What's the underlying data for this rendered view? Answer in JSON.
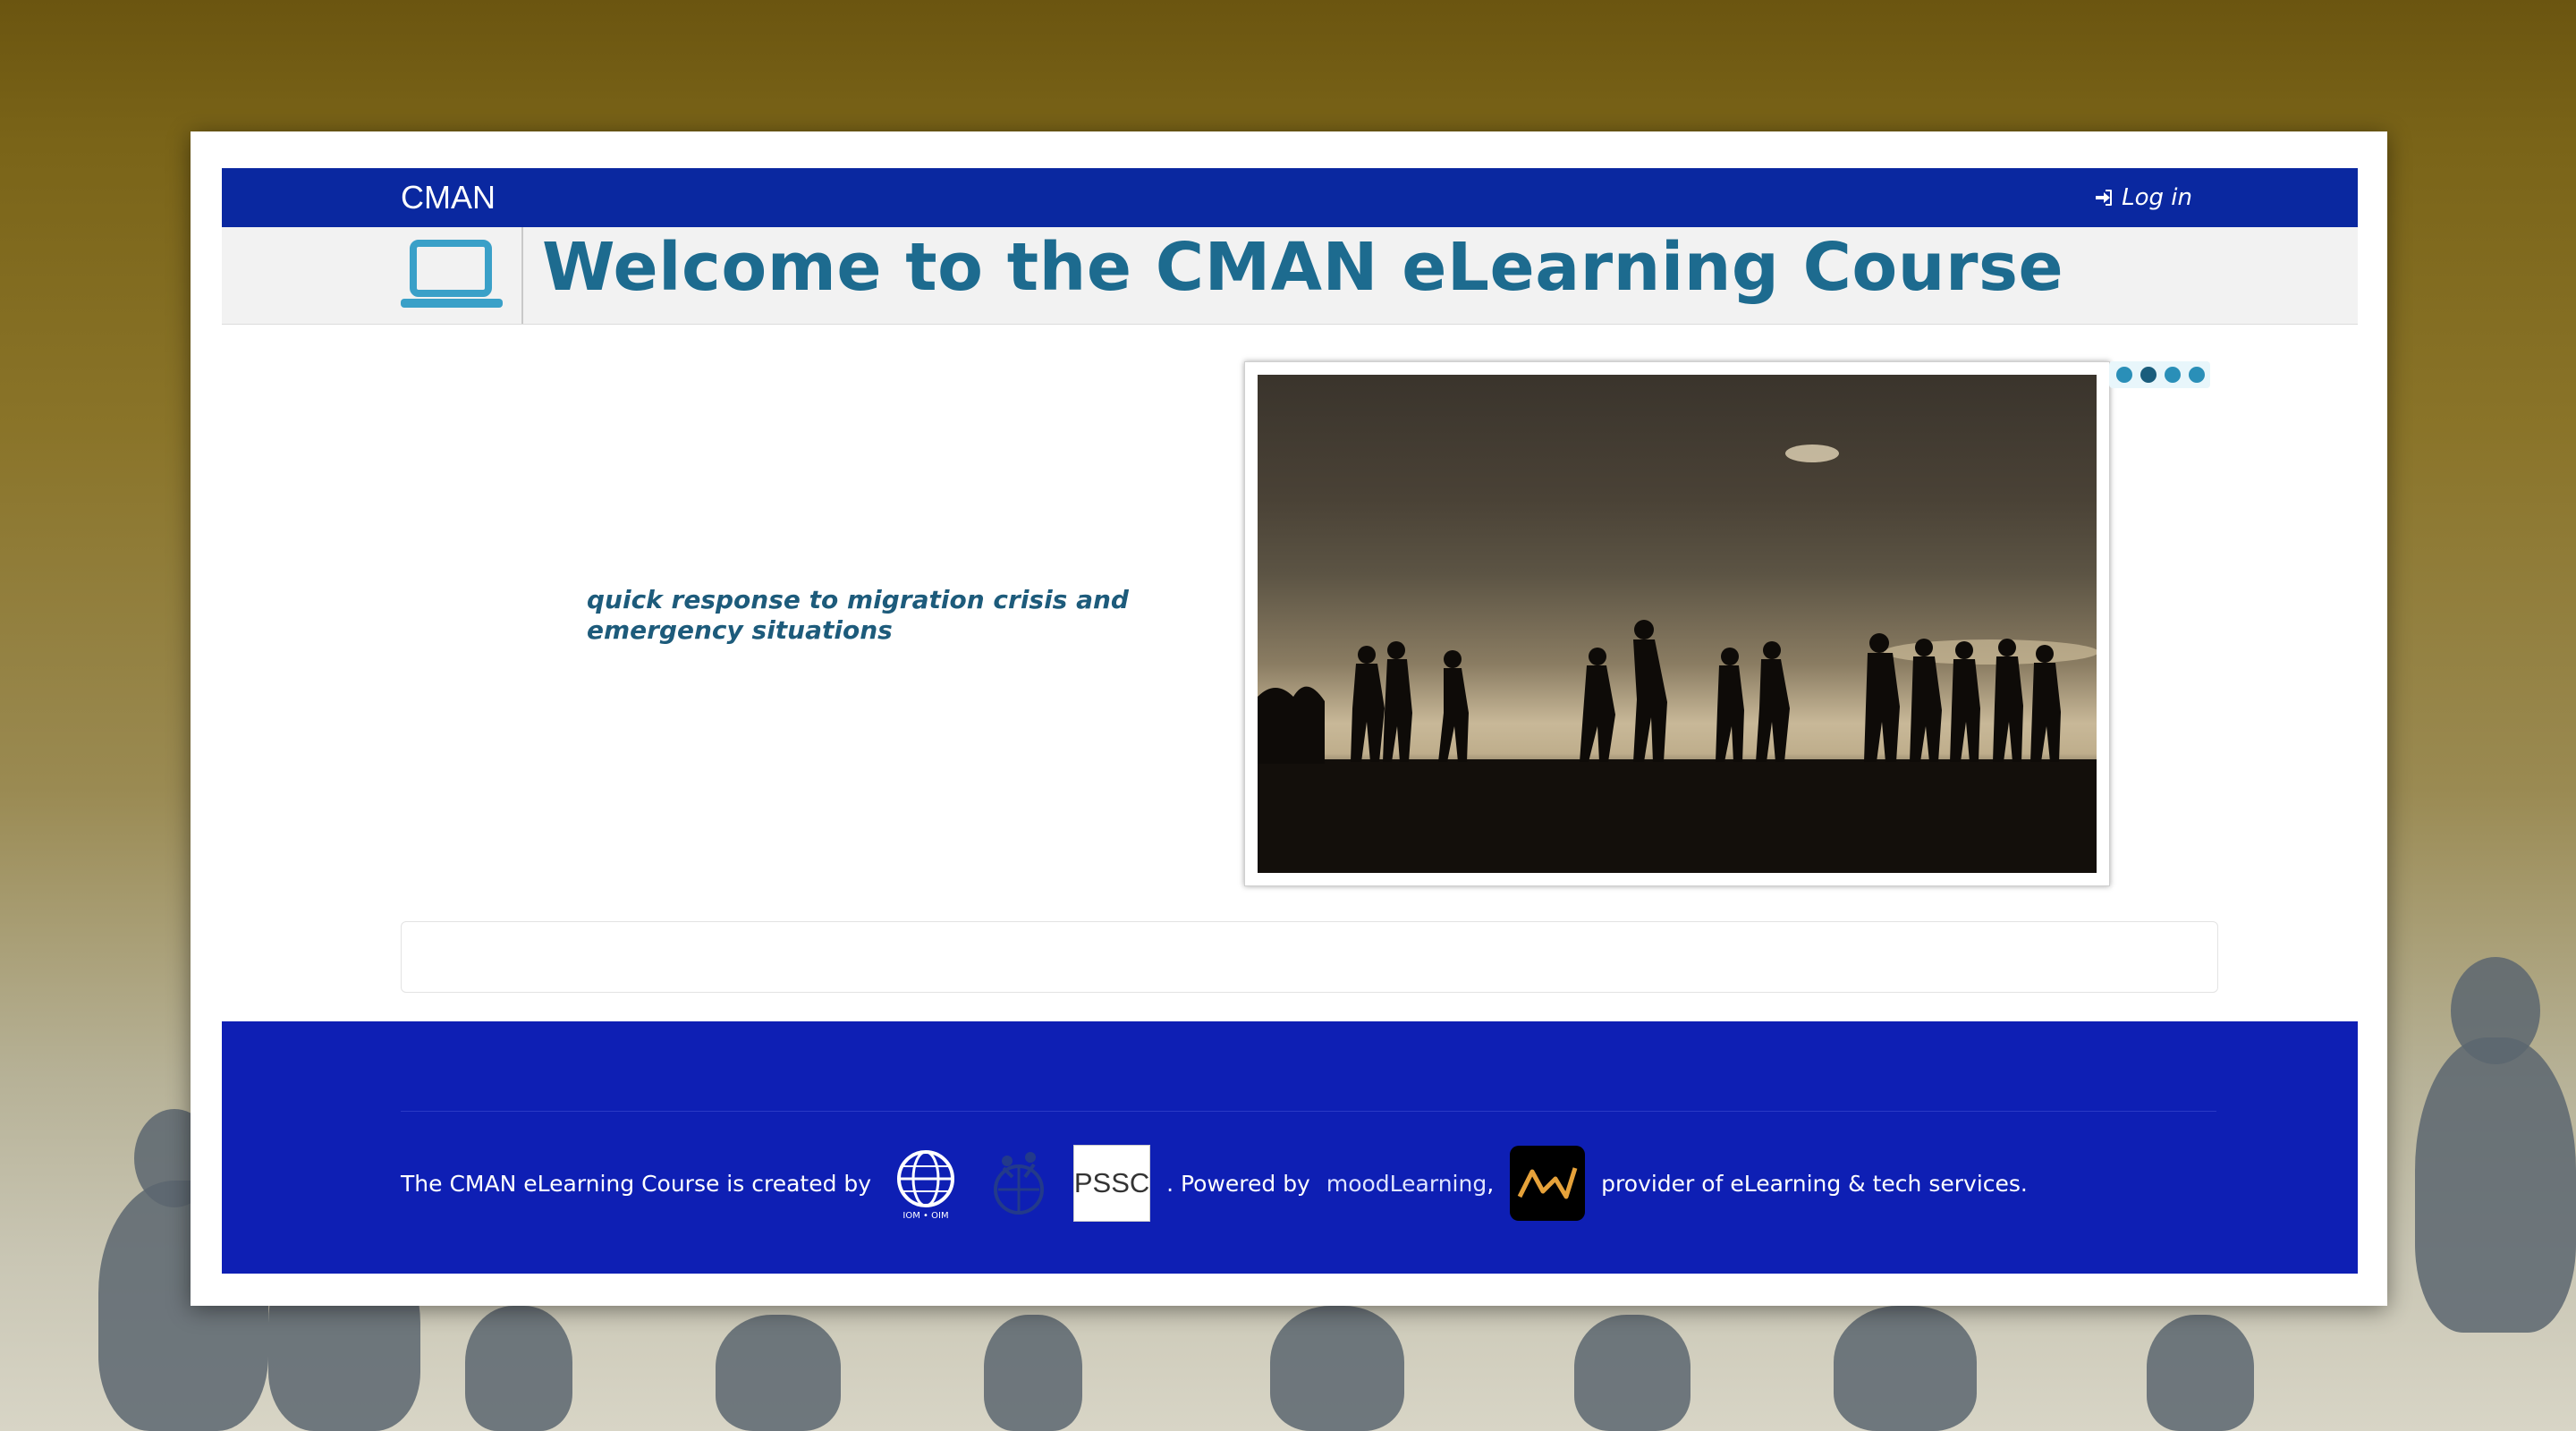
{
  "navbar": {
    "brand": "CMAN",
    "login_label": "Log in"
  },
  "header": {
    "title": "Welcome to the CMAN eLearning Course",
    "logo_icon": "laptop-icon"
  },
  "main": {
    "tagline": "quick response to migration crisis and emergency situations",
    "slider": {
      "image_icon": "migrants-silhouette-image",
      "dots": [
        {
          "label": "1"
        },
        {
          "label": "2"
        },
        {
          "label": "3"
        },
        {
          "label": "4"
        }
      ],
      "active_index": 2
    }
  },
  "footer": {
    "created_by": "The CMAN eLearning Course is created by",
    "iom_label": "IOM • OIM",
    "pssc_label": "PSSC",
    "powered_by": ". Powered by",
    "moodlearning": "moodLearning",
    "comma": ",",
    "provider": "provider of eLearning & tech services."
  },
  "colors": {
    "navbar": "#0a28a0",
    "footer": "#0e1fb4",
    "title": "#1d6b8f",
    "accent": "#2a8fb8"
  }
}
